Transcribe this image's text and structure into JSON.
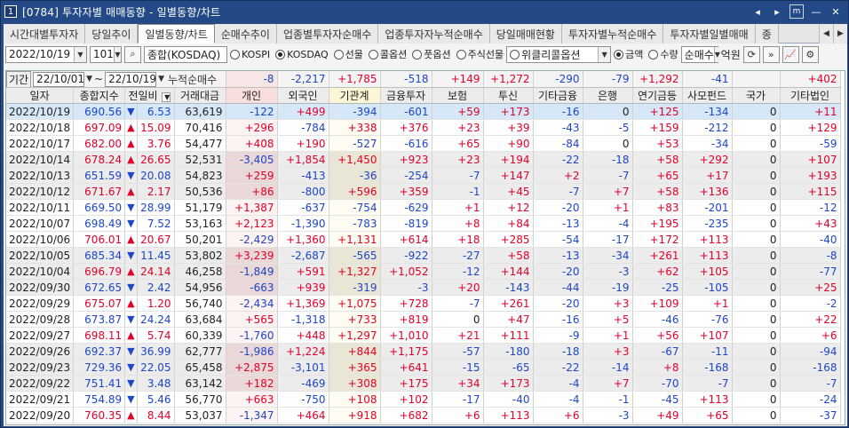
{
  "window": {
    "screen_no": "1",
    "title": "[0784] 투자자별 매매동향 - 일별동향/차트",
    "ctrl_prev": "◂",
    "ctrl_next": "▸",
    "ctrl_box": "m",
    "ctrl_min": "—",
    "ctrl_close": "✕"
  },
  "tabs": [
    {
      "label": "시간대별투자자",
      "active": false
    },
    {
      "label": "당일추이",
      "active": false
    },
    {
      "label": "일별동향/차트",
      "active": true
    },
    {
      "label": "순매수추이",
      "active": false
    },
    {
      "label": "업종별투자자순매수",
      "active": false
    },
    {
      "label": "업종투자자누적순매수",
      "active": false
    },
    {
      "label": "당일매매현황",
      "active": false
    },
    {
      "label": "투자자별누적순매수",
      "active": false
    },
    {
      "label": "투자자별일별매매",
      "active": false
    },
    {
      "label": "종",
      "active": false
    }
  ],
  "toolbar": {
    "date": "2022/10/19",
    "market_code": "101",
    "market_name": "종합(KOSDAQ)",
    "radios_market": [
      {
        "label": "KOSPI",
        "on": false
      },
      {
        "label": "KOSDAQ",
        "on": true
      },
      {
        "label": "선물",
        "on": false
      },
      {
        "label": "콜옵션",
        "on": false
      },
      {
        "label": "풋옵션",
        "on": false
      },
      {
        "label": "주식선물",
        "on": false
      }
    ],
    "weekly_option": "위클리콜옵션",
    "radios_unit": [
      {
        "label": "금액",
        "on": true
      },
      {
        "label": "수량",
        "on": false
      }
    ],
    "net_buy": "순매수",
    "amount_unit": "억원"
  },
  "period": {
    "label": "기간",
    "from": "22/10/01",
    "sep": "~",
    "to": "22/10/19",
    "cum_label": "누적순매수"
  },
  "summary": {
    "개인": "-8",
    "외국인": "-2,217",
    "기관계": "+1,785",
    "금융투자": "-518",
    "보험": "+149",
    "투신": "+1,272",
    "기타금융": "-290",
    "은행": "-79",
    "연기금등": "+1,292",
    "사모펀드": "-41",
    "국가": "",
    "기타법인": "+402"
  },
  "headers": [
    "일자",
    "종합지수",
    "전일비",
    "거래대금",
    "개인",
    "외국인",
    "기관계",
    "금융투자",
    "보험",
    "투신",
    "기타금융",
    "은행",
    "연기금등",
    "사모펀드",
    "국가",
    "기타법인"
  ],
  "rows": [
    {
      "date": "2022/10/19",
      "index": "690.56",
      "dir": "down",
      "chg": "6.53",
      "vol": "63,619",
      "v": [
        "-122",
        "+499",
        "-394",
        "-601",
        "+59",
        "+173",
        "-16",
        "0",
        "+125",
        "-134",
        "0",
        "+11"
      ]
    },
    {
      "date": "2022/10/18",
      "index": "697.09",
      "dir": "up",
      "chg": "15.09",
      "vol": "70,416",
      "v": [
        "+296",
        "-784",
        "+338",
        "+376",
        "+23",
        "+39",
        "-43",
        "-5",
        "+159",
        "-212",
        "0",
        "+129"
      ]
    },
    {
      "date": "2022/10/17",
      "index": "682.00",
      "dir": "up",
      "chg": "3.76",
      "vol": "54,477",
      "v": [
        "+408",
        "+190",
        "-527",
        "-616",
        "+65",
        "+90",
        "-84",
        "0",
        "+53",
        "-34",
        "0",
        "-59"
      ]
    },
    {
      "date": "2022/10/14",
      "index": "678.24",
      "dir": "up",
      "chg": "26.65",
      "vol": "52,531",
      "v": [
        "-3,405",
        "+1,854",
        "+1,450",
        "+923",
        "+23",
        "+194",
        "-22",
        "-18",
        "+58",
        "+292",
        "0",
        "+107"
      ]
    },
    {
      "date": "2022/10/13",
      "index": "651.59",
      "dir": "down",
      "chg": "20.08",
      "vol": "54,823",
      "v": [
        "+259",
        "-413",
        "-36",
        "-254",
        "-7",
        "+147",
        "+2",
        "-7",
        "+65",
        "+17",
        "0",
        "+193"
      ]
    },
    {
      "date": "2022/10/12",
      "index": "671.67",
      "dir": "up",
      "chg": "2.17",
      "vol": "50,536",
      "v": [
        "+86",
        "-800",
        "+596",
        "+359",
        "-1",
        "+45",
        "-7",
        "+7",
        "+58",
        "+136",
        "0",
        "+115"
      ]
    },
    {
      "date": "2022/10/11",
      "index": "669.50",
      "dir": "down",
      "chg": "28.99",
      "vol": "51,179",
      "v": [
        "+1,387",
        "-637",
        "-754",
        "-629",
        "+1",
        "+12",
        "-20",
        "+1",
        "+83",
        "-201",
        "0",
        "-12"
      ]
    },
    {
      "date": "2022/10/07",
      "index": "698.49",
      "dir": "down",
      "chg": "7.52",
      "vol": "53,163",
      "v": [
        "+2,123",
        "-1,390",
        "-783",
        "-819",
        "+8",
        "+84",
        "-13",
        "-4",
        "+195",
        "-235",
        "0",
        "+43"
      ]
    },
    {
      "date": "2022/10/06",
      "index": "706.01",
      "dir": "up",
      "chg": "20.67",
      "vol": "50,201",
      "v": [
        "-2,429",
        "+1,360",
        "+1,131",
        "+614",
        "+18",
        "+285",
        "-54",
        "-17",
        "+172",
        "+113",
        "0",
        "-40"
      ]
    },
    {
      "date": "2022/10/05",
      "index": "685.34",
      "dir": "down",
      "chg": "11.45",
      "vol": "53,802",
      "v": [
        "+3,239",
        "-2,687",
        "-565",
        "-922",
        "-27",
        "+58",
        "-13",
        "-34",
        "+261",
        "+113",
        "0",
        "-8"
      ]
    },
    {
      "date": "2022/10/04",
      "index": "696.79",
      "dir": "up",
      "chg": "24.14",
      "vol": "46,258",
      "v": [
        "-1,849",
        "+591",
        "+1,327",
        "+1,052",
        "-12",
        "+144",
        "-20",
        "-3",
        "+62",
        "+105",
        "0",
        "-77"
      ]
    },
    {
      "date": "2022/09/30",
      "index": "672.65",
      "dir": "down",
      "chg": "2.42",
      "vol": "54,956",
      "v": [
        "-663",
        "+939",
        "-319",
        "-3",
        "+20",
        "-143",
        "-44",
        "-19",
        "-25",
        "-105",
        "0",
        "+25"
      ]
    },
    {
      "date": "2022/09/29",
      "index": "675.07",
      "dir": "up",
      "chg": "1.20",
      "vol": "56,740",
      "v": [
        "-2,434",
        "+1,369",
        "+1,075",
        "+728",
        "-7",
        "+261",
        "-20",
        "+3",
        "+109",
        "+1",
        "0",
        "-2"
      ]
    },
    {
      "date": "2022/09/28",
      "index": "673.87",
      "dir": "down",
      "chg": "24.24",
      "vol": "63,684",
      "v": [
        "+565",
        "-1,318",
        "+733",
        "+819",
        "0",
        "+47",
        "-16",
        "+5",
        "-46",
        "-76",
        "0",
        "+22"
      ]
    },
    {
      "date": "2022/09/27",
      "index": "698.11",
      "dir": "up",
      "chg": "5.74",
      "vol": "60,339",
      "v": [
        "-1,760",
        "+448",
        "+1,297",
        "+1,010",
        "+21",
        "+111",
        "-9",
        "+1",
        "+56",
        "+107",
        "0",
        "+6"
      ]
    },
    {
      "date": "2022/09/26",
      "index": "692.37",
      "dir": "down",
      "chg": "36.99",
      "vol": "62,777",
      "v": [
        "-1,986",
        "+1,224",
        "+844",
        "+1,175",
        "-57",
        "-180",
        "-18",
        "+3",
        "-67",
        "-11",
        "0",
        "-94"
      ]
    },
    {
      "date": "2022/09/23",
      "index": "729.36",
      "dir": "down",
      "chg": "22.05",
      "vol": "65,458",
      "v": [
        "+2,875",
        "-3,101",
        "+365",
        "+641",
        "-15",
        "-65",
        "-22",
        "-14",
        "+8",
        "-168",
        "0",
        "-168"
      ]
    },
    {
      "date": "2022/09/22",
      "index": "751.41",
      "dir": "down",
      "chg": "3.48",
      "vol": "63,142",
      "v": [
        "+182",
        "-469",
        "+308",
        "+175",
        "+34",
        "+173",
        "-4",
        "+7",
        "-70",
        "-7",
        "0",
        "-7"
      ]
    },
    {
      "date": "2022/09/21",
      "index": "754.89",
      "dir": "down",
      "chg": "5.46",
      "vol": "56,770",
      "v": [
        "+663",
        "-750",
        "+108",
        "+102",
        "-17",
        "-40",
        "-4",
        "-1",
        "-45",
        "+113",
        "0",
        "-24"
      ]
    },
    {
      "date": "2022/09/20",
      "index": "760.35",
      "dir": "up",
      "chg": "8.44",
      "vol": "53,037",
      "v": [
        "-1,347",
        "+464",
        "+918",
        "+682",
        "+6",
        "+113",
        "+6",
        "-3",
        "+49",
        "+65",
        "0",
        "-37"
      ]
    }
  ],
  "colors": {
    "positive": "#e0002a",
    "negative": "#1d46c8",
    "selected_row": "#d6e8f7"
  }
}
